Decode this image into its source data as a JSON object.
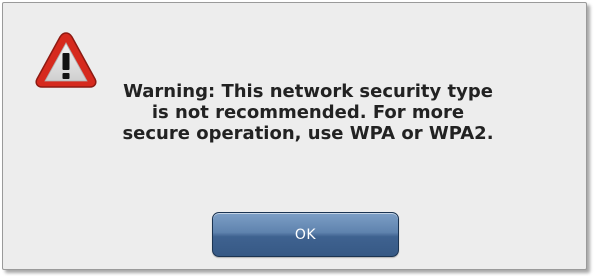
{
  "dialog": {
    "message_lines": [
      "Warning: This network security type",
      "is not recommended. For more",
      "secure operation, use WPA or WPA2."
    ],
    "ok_label": "OK",
    "icon": "warning-triangle-icon",
    "colors": {
      "icon_red": "#d62a1e",
      "button_blue": "#4a6e9c",
      "background": "#ededed"
    }
  }
}
